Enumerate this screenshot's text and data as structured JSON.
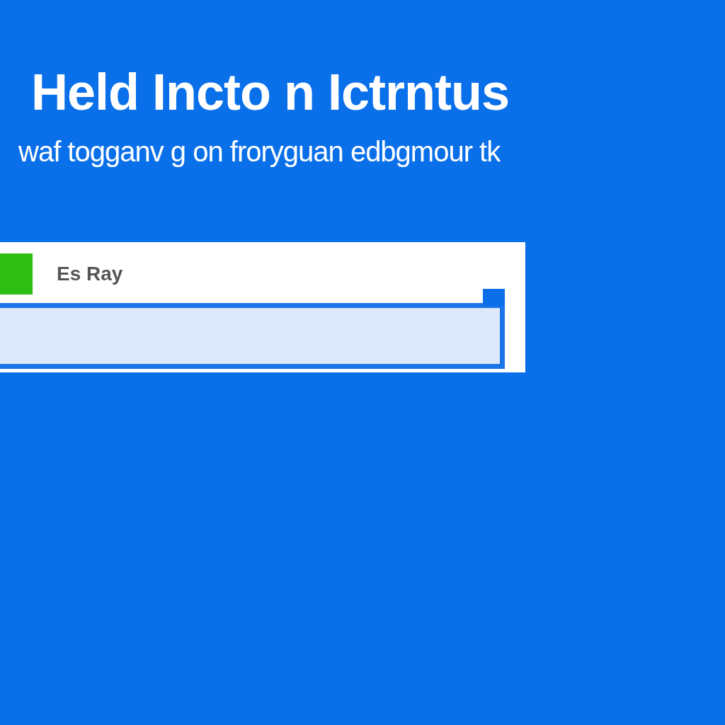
{
  "heading": {
    "title": "Held Incto n Ictrntus",
    "subtitle": "waf togganv g on froryguan edbgmour tk"
  },
  "card": {
    "label": "Es Ray"
  }
}
